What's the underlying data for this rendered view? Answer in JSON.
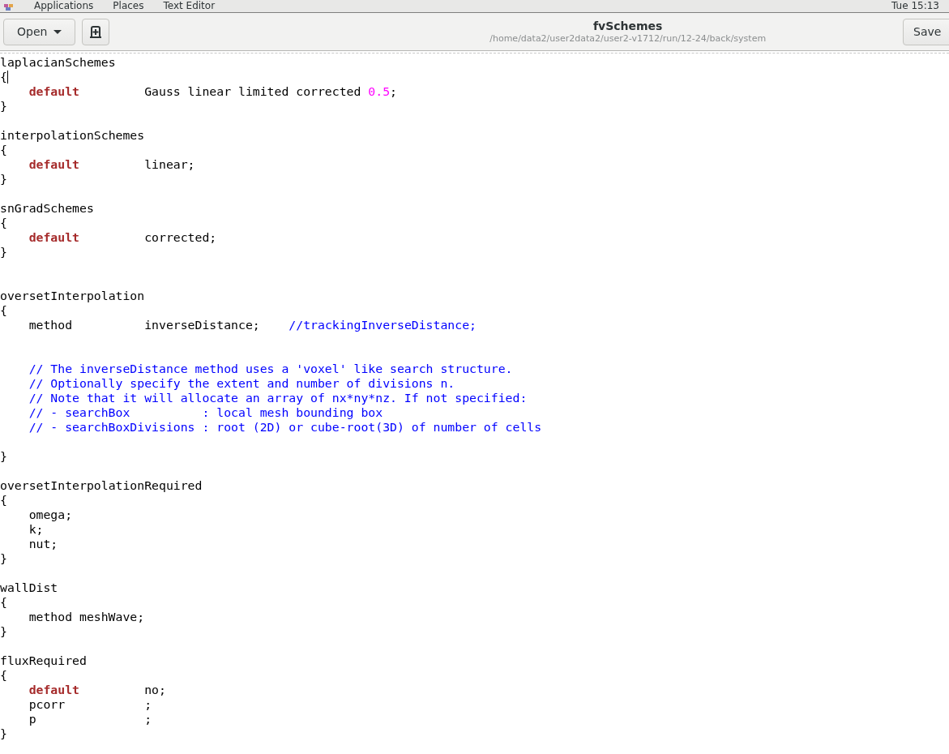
{
  "top_panel": {
    "menus": [
      "Applications",
      "Places",
      "Text Editor"
    ],
    "clock": "Tue 15:13"
  },
  "header": {
    "open_button": "Open",
    "title": "fvSchemes",
    "subtitle": "/home/data2/user2data2/user2-v1712/run/12-24/back/system",
    "save_button": "Save"
  },
  "editor": {
    "lines": [
      {
        "kind": "code",
        "cursor": false,
        "tokens": [
          {
            "kind": "plain",
            "text": "laplacianSchemes"
          }
        ]
      },
      {
        "kind": "code",
        "cursor": true,
        "tokens": [
          {
            "kind": "plain",
            "text": "{"
          }
        ]
      },
      {
        "kind": "code",
        "cursor": false,
        "indent": true,
        "tokens": [
          {
            "kind": "keyword",
            "text": "default"
          },
          {
            "kind": "plain",
            "text": "         Gauss linear limited corrected "
          },
          {
            "kind": "number",
            "text": "0.5"
          },
          {
            "kind": "plain",
            "text": ";"
          }
        ]
      },
      {
        "kind": "code",
        "cursor": false,
        "tokens": [
          {
            "kind": "plain",
            "text": "}"
          }
        ]
      },
      {
        "kind": "blank"
      },
      {
        "kind": "code",
        "cursor": false,
        "tokens": [
          {
            "kind": "plain",
            "text": "interpolationSchemes"
          }
        ]
      },
      {
        "kind": "code",
        "cursor": false,
        "tokens": [
          {
            "kind": "plain",
            "text": "{"
          }
        ]
      },
      {
        "kind": "code",
        "cursor": false,
        "indent": true,
        "tokens": [
          {
            "kind": "keyword",
            "text": "default"
          },
          {
            "kind": "plain",
            "text": "         linear;"
          }
        ]
      },
      {
        "kind": "code",
        "cursor": false,
        "tokens": [
          {
            "kind": "plain",
            "text": "}"
          }
        ]
      },
      {
        "kind": "blank"
      },
      {
        "kind": "code",
        "cursor": false,
        "tokens": [
          {
            "kind": "plain",
            "text": "snGradSchemes"
          }
        ]
      },
      {
        "kind": "code",
        "cursor": false,
        "tokens": [
          {
            "kind": "plain",
            "text": "{"
          }
        ]
      },
      {
        "kind": "code",
        "cursor": false,
        "indent": true,
        "tokens": [
          {
            "kind": "keyword",
            "text": "default"
          },
          {
            "kind": "plain",
            "text": "         corrected;"
          }
        ]
      },
      {
        "kind": "code",
        "cursor": false,
        "tokens": [
          {
            "kind": "plain",
            "text": "}"
          }
        ]
      },
      {
        "kind": "blank"
      },
      {
        "kind": "blank"
      },
      {
        "kind": "code",
        "cursor": false,
        "tokens": [
          {
            "kind": "plain",
            "text": "oversetInterpolation"
          }
        ]
      },
      {
        "kind": "code",
        "cursor": false,
        "tokens": [
          {
            "kind": "plain",
            "text": "{"
          }
        ]
      },
      {
        "kind": "code",
        "cursor": false,
        "indent": true,
        "tokens": [
          {
            "kind": "plain",
            "text": "method          inverseDistance;    "
          },
          {
            "kind": "comment",
            "text": "//trackingInverseDistance;"
          }
        ]
      },
      {
        "kind": "blank"
      },
      {
        "kind": "blank"
      },
      {
        "kind": "code",
        "cursor": false,
        "indent": true,
        "tokens": [
          {
            "kind": "comment",
            "text": "// The inverseDistance method uses a 'voxel' like search structure."
          }
        ]
      },
      {
        "kind": "code",
        "cursor": false,
        "indent": true,
        "tokens": [
          {
            "kind": "comment",
            "text": "// Optionally specify the extent and number of divisions n."
          }
        ]
      },
      {
        "kind": "code",
        "cursor": false,
        "indent": true,
        "tokens": [
          {
            "kind": "comment",
            "text": "// Note that it will allocate an array of nx*ny*nz. If not specified:"
          }
        ]
      },
      {
        "kind": "code",
        "cursor": false,
        "indent": true,
        "tokens": [
          {
            "kind": "comment",
            "text": "// - searchBox          : local mesh bounding box"
          }
        ]
      },
      {
        "kind": "code",
        "cursor": false,
        "indent": true,
        "tokens": [
          {
            "kind": "comment",
            "text": "// - searchBoxDivisions : root (2D) or cube-root(3D) of number of cells"
          }
        ]
      },
      {
        "kind": "blank"
      },
      {
        "kind": "code",
        "cursor": false,
        "tokens": [
          {
            "kind": "plain",
            "text": "}"
          }
        ]
      },
      {
        "kind": "blank"
      },
      {
        "kind": "code",
        "cursor": false,
        "tokens": [
          {
            "kind": "plain",
            "text": "oversetInterpolationRequired"
          }
        ]
      },
      {
        "kind": "code",
        "cursor": false,
        "tokens": [
          {
            "kind": "plain",
            "text": "{"
          }
        ]
      },
      {
        "kind": "code",
        "cursor": false,
        "indent": true,
        "tokens": [
          {
            "kind": "plain",
            "text": "omega;"
          }
        ]
      },
      {
        "kind": "code",
        "cursor": false,
        "indent": true,
        "tokens": [
          {
            "kind": "plain",
            "text": "k;"
          }
        ]
      },
      {
        "kind": "code",
        "cursor": false,
        "indent": true,
        "tokens": [
          {
            "kind": "plain",
            "text": "nut;"
          }
        ]
      },
      {
        "kind": "code",
        "cursor": false,
        "tokens": [
          {
            "kind": "plain",
            "text": "}"
          }
        ]
      },
      {
        "kind": "blank"
      },
      {
        "kind": "code",
        "cursor": false,
        "tokens": [
          {
            "kind": "plain",
            "text": "wallDist"
          }
        ]
      },
      {
        "kind": "code",
        "cursor": false,
        "tokens": [
          {
            "kind": "plain",
            "text": "{"
          }
        ]
      },
      {
        "kind": "code",
        "cursor": false,
        "indent": true,
        "tokens": [
          {
            "kind": "plain",
            "text": "method meshWave;"
          }
        ]
      },
      {
        "kind": "code",
        "cursor": false,
        "tokens": [
          {
            "kind": "plain",
            "text": "}"
          }
        ]
      },
      {
        "kind": "blank"
      },
      {
        "kind": "code",
        "cursor": false,
        "tokens": [
          {
            "kind": "plain",
            "text": "fluxRequired"
          }
        ]
      },
      {
        "kind": "code",
        "cursor": false,
        "tokens": [
          {
            "kind": "plain",
            "text": "{"
          }
        ]
      },
      {
        "kind": "code",
        "cursor": false,
        "indent": true,
        "tokens": [
          {
            "kind": "keyword",
            "text": "default"
          },
          {
            "kind": "plain",
            "text": "         no;"
          }
        ]
      },
      {
        "kind": "code",
        "cursor": false,
        "indent": true,
        "tokens": [
          {
            "kind": "plain",
            "text": "pcorr           ;"
          }
        ]
      },
      {
        "kind": "code",
        "cursor": false,
        "indent": true,
        "tokens": [
          {
            "kind": "plain",
            "text": "p               ;"
          }
        ]
      },
      {
        "kind": "code",
        "cursor": false,
        "tokens": [
          {
            "kind": "plain",
            "text": "}"
          }
        ]
      }
    ]
  }
}
